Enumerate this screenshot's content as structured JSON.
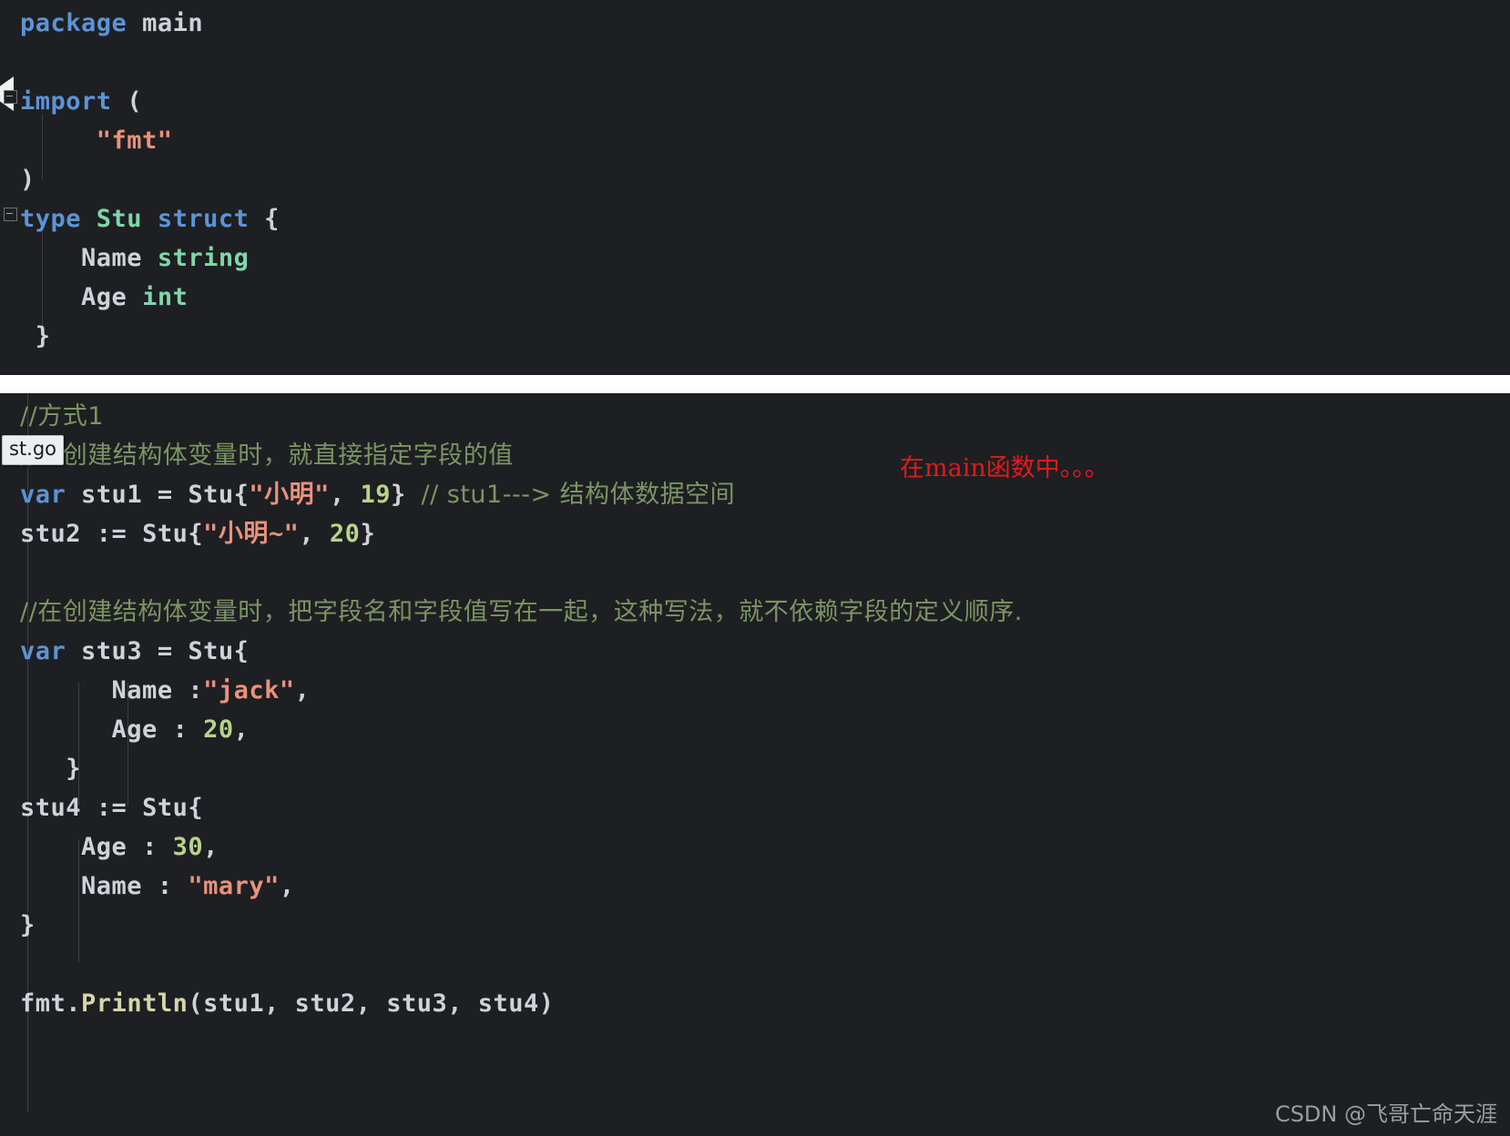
{
  "panels": {
    "top": {
      "name": "go-struct-definition-panel",
      "lines": [
        {
          "id": "l1",
          "text": "package main"
        },
        {
          "id": "l2",
          "text": ""
        },
        {
          "id": "l3",
          "text": "import ("
        },
        {
          "id": "l4",
          "text": "    \"fmt\""
        },
        {
          "id": "l5",
          "text": ")"
        },
        {
          "id": "l6",
          "text": "type Stu struct {"
        },
        {
          "id": "l7",
          "text": "    Name string"
        },
        {
          "id": "l8",
          "text": "    Age int"
        },
        {
          "id": "l9",
          "text": "}"
        }
      ]
    },
    "bottom": {
      "name": "go-struct-initialization-panel",
      "lines": [
        {
          "id": "b1",
          "text": "//方式1"
        },
        {
          "id": "b2",
          "text": "//在创建结构体变量时，就直接指定字段的值"
        },
        {
          "id": "b3",
          "text": "var stu1 = Stu{\"小明\", 19} // stu1---> 结构体数据空间"
        },
        {
          "id": "b4",
          "text": "stu2 := Stu{\"小明~\", 20}"
        },
        {
          "id": "b5",
          "text": ""
        },
        {
          "id": "b6",
          "text": "//在创建结构体变量时，把字段名和字段值写在一起，这种写法，就不依赖字段的定义顺序."
        },
        {
          "id": "b7",
          "text": "var stu3 = Stu{"
        },
        {
          "id": "b8",
          "text": "        Name :\"jack\","
        },
        {
          "id": "b9",
          "text": "        Age : 20,"
        },
        {
          "id": "b10",
          "text": "    }"
        },
        {
          "id": "b11",
          "text": "stu4 := Stu{"
        },
        {
          "id": "b12",
          "text": "    Age : 30,"
        },
        {
          "id": "b13",
          "text": "    Name : \"mary\","
        },
        {
          "id": "b14",
          "text": "}"
        },
        {
          "id": "b15",
          "text": ""
        },
        {
          "id": "b16",
          "text": "fmt.Println(stu1, stu2, stu3, stu4)"
        }
      ]
    }
  },
  "tokens": {
    "kw_package": "package",
    "pkg_main": "main",
    "kw_import": "import",
    "paren_open": "(",
    "paren_close": ")",
    "str_fmt": "\"fmt\"",
    "kw_type": "type",
    "type_stu": "Stu",
    "kw_struct": "struct",
    "brace_open": "{",
    "brace_close": "}",
    "field_name": "Name",
    "type_string": "string",
    "field_age": "Age",
    "type_int": "int",
    "kw_var": "var",
    "id_stu1": "stu1",
    "id_stu2": "stu2",
    "id_stu3": "stu3",
    "id_stu4": "stu4",
    "eq": "=",
    "colon_eq": ":=",
    "str_xiaoming": "\"小明\"",
    "str_xiaoming_tilde": "\"小明~\"",
    "num_19": "19",
    "num_20": "20",
    "num_30": "30",
    "str_jack": "\"jack\"",
    "str_mary": "\"mary\"",
    "comment_way1": "//方式1",
    "comment_direct": "//在创建结构体变量时，就直接指定字段的值",
    "comment_stu1_trail": "// stu1---> 结构体数据空间",
    "comment_named": "//在创建结构体变量时，把字段名和字段值写在一起，这种写法，就不依赖字段的定义顺序.",
    "fmt_pkg": "fmt",
    "dot": ".",
    "fn_println": "Println",
    "comma": ",",
    "colon": ":"
  },
  "overlays": {
    "tooltip_label": "st.go",
    "red_annotation": "在main函数中。。。",
    "watermark": "CSDN @飞哥亡命天涯"
  },
  "colors": {
    "editor_background": "#1e1f22",
    "page_background": "#ffffff",
    "keyword": "#5c94d6",
    "type": "#7fd6a9",
    "string": "#e8927c",
    "number": "#b8d38a",
    "comment": "#7c9464",
    "identifier": "#cfd2d6",
    "function": "#d6d6a8",
    "annotation_red": "#e01b1b",
    "watermark_gray": "#9b9ea1",
    "tooltip_background": "#eceff1"
  }
}
